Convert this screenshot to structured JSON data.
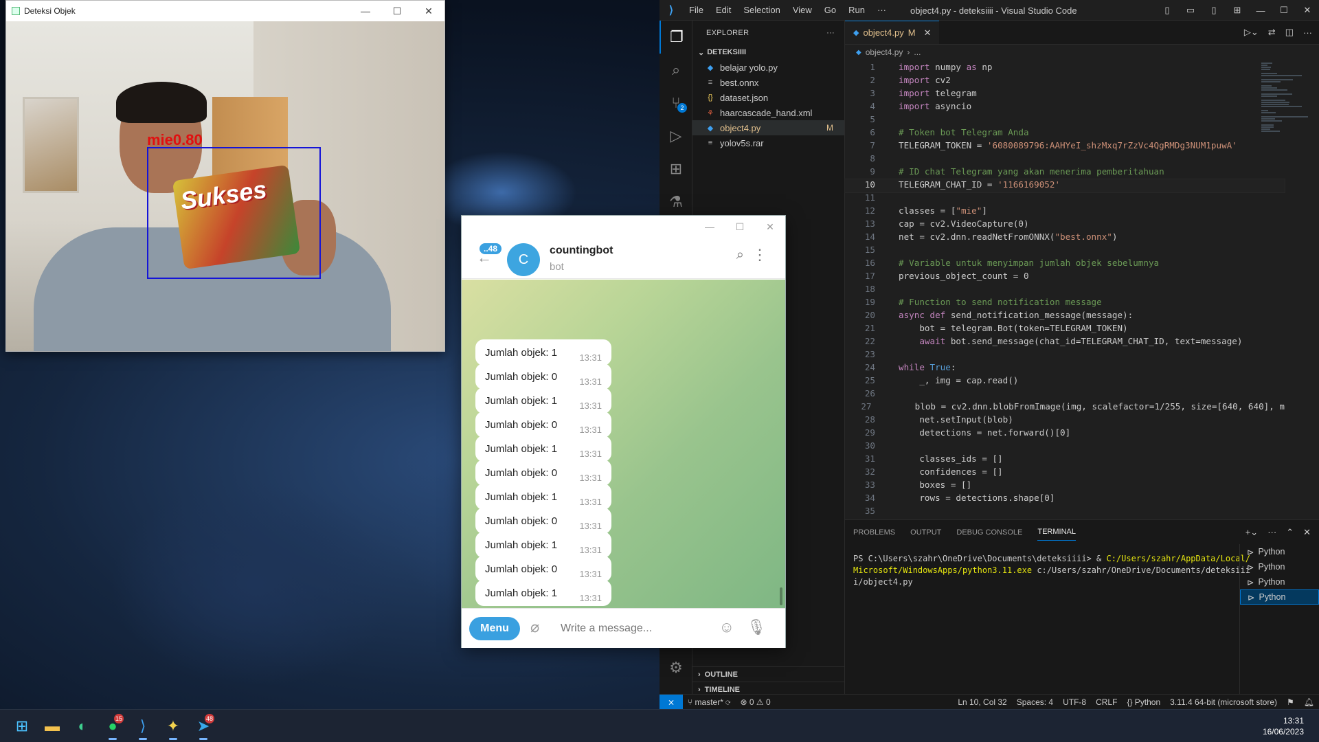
{
  "camera_window": {
    "title": "Deteksi Objek",
    "detection_label": "mie0.80",
    "package_text": "Sukses"
  },
  "vscode": {
    "window_title": "object4.py - deteksiiii - Visual Studio Code",
    "menu": [
      "File",
      "Edit",
      "Selection",
      "View",
      "Go",
      "Run",
      "···"
    ],
    "explorer_title": "EXPLORER",
    "folder": "DETEKSIIII",
    "files": [
      {
        "icon": "python-file-icon",
        "glyph": "◆",
        "color": "#3ea0f0",
        "name": "belajar yolo.py",
        "modified": ""
      },
      {
        "icon": "file-icon",
        "glyph": "≡",
        "color": "#aaaaaa",
        "name": "best.onnx",
        "modified": ""
      },
      {
        "icon": "json-file-icon",
        "glyph": "{}",
        "color": "#e8c65a",
        "name": "dataset.json",
        "modified": ""
      },
      {
        "icon": "xml-file-icon",
        "glyph": "⚘",
        "color": "#e06040",
        "name": "haarcascade_hand.xml",
        "modified": ""
      },
      {
        "icon": "python-file-icon",
        "glyph": "◆",
        "color": "#3ea0f0",
        "name": "object4.py",
        "modified": "M"
      },
      {
        "icon": "file-icon",
        "glyph": "≡",
        "color": "#aaaaaa",
        "name": "yolov5s.rar",
        "modified": ""
      }
    ],
    "outline": "OUTLINE",
    "timeline": "TIMELINE",
    "tab": {
      "name": "object4.py",
      "flag": "M"
    },
    "breadcrumb": [
      "object4.py",
      "›",
      "..."
    ],
    "code_lines": [
      "import numpy as np",
      "import cv2",
      "import telegram",
      "import asyncio",
      "",
      "# Token bot Telegram Anda",
      "TELEGRAM_TOKEN = '6080089796:AAHYeI_shzMxq7rZzVc4QgRMDg3NUM1puwA'",
      "",
      "# ID chat Telegram yang akan menerima pemberitahuan",
      "TELEGRAM_CHAT_ID = '1166169052'",
      "",
      "classes = [\"mie\"]",
      "cap = cv2.VideoCapture(0)",
      "net = cv2.dnn.readNetFromONNX(\"best.onnx\")",
      "",
      "# Variable untuk menyimpan jumlah objek sebelumnya",
      "previous_object_count = 0",
      "",
      "# Function to send notification message",
      "async def send_notification_message(message):",
      "    bot = telegram.Bot(token=TELEGRAM_TOKEN)",
      "    await bot.send_message(chat_id=TELEGRAM_CHAT_ID, text=message)",
      "",
      "while True:",
      "    _, img = cap.read()",
      "",
      "    blob = cv2.dnn.blobFromImage(img, scalefactor=1/255, size=[640, 640], m",
      "    net.setInput(blob)",
      "    detections = net.forward()[0]",
      "",
      "    classes_ids = []",
      "    confidences = []",
      "    boxes = []",
      "    rows = detections.shape[0]",
      ""
    ],
    "current_line": 10,
    "panel_tabs": [
      "PROBLEMS",
      "OUTPUT",
      "DEBUG CONSOLE",
      "TERMINAL"
    ],
    "active_panel_tab": "TERMINAL",
    "terminal_prompt": "PS C:\\Users\\szahr\\OneDrive\\Documents\\deteksiiii> & ",
    "terminal_exe": "C:/Users/szahr/AppData/Local/Microsoft/WindowsApps/python3.11.exe",
    "terminal_arg": " c:/Users/szahr/OneDrive/Documents/deteksiiii/object4.py",
    "terminals": [
      "Python",
      "Python",
      "Python",
      "Python"
    ],
    "status": {
      "branch": "master*",
      "errors": "0",
      "warnings": "0",
      "position": "Ln 10, Col 32",
      "spaces": "Spaces: 4",
      "encoding": "UTF-8",
      "eol": "CRLF",
      "language": "Python",
      "interpreter": "3.11.4 64-bit (microsoft store)"
    },
    "scm_badge": "2"
  },
  "telegram": {
    "unread": "..48",
    "avatar_letter": "C",
    "chat_name": "countingbot",
    "chat_sub": "bot",
    "messages": [
      {
        "text": "Jumlah objek: 1",
        "time": "13:31"
      },
      {
        "text": "Jumlah objek: 0",
        "time": "13:31"
      },
      {
        "text": "Jumlah objek: 1",
        "time": "13:31"
      },
      {
        "text": "Jumlah objek: 0",
        "time": "13:31"
      },
      {
        "text": "Jumlah objek: 1",
        "time": "13:31"
      },
      {
        "text": "Jumlah objek: 0",
        "time": "13:31"
      },
      {
        "text": "Jumlah objek: 1",
        "time": "13:31"
      },
      {
        "text": "Jumlah objek: 0",
        "time": "13:31"
      },
      {
        "text": "Jumlah objek: 1",
        "time": "13:31"
      },
      {
        "text": "Jumlah objek: 0",
        "time": "13:31"
      },
      {
        "text": "Jumlah objek: 1",
        "time": "13:31"
      }
    ],
    "menu_label": "Menu",
    "input_placeholder": "Write a message..."
  },
  "taskbar": {
    "apps": [
      {
        "name": "start-button",
        "glyph": "⊞",
        "color": "#4cc2ff",
        "badge": ""
      },
      {
        "name": "file-explorer-icon",
        "glyph": "▬",
        "color": "#f2c14e",
        "badge": ""
      },
      {
        "name": "edge-icon",
        "glyph": "◐",
        "color": "#3ecf8e",
        "badge": ""
      },
      {
        "name": "whatsapp-icon",
        "glyph": "●",
        "color": "#25d366",
        "badge": "15"
      },
      {
        "name": "vscode-icon",
        "glyph": "⟩",
        "color": "#3ea0f0",
        "badge": ""
      },
      {
        "name": "python-icon",
        "glyph": "✦",
        "color": "#f2d24e",
        "badge": ""
      },
      {
        "name": "telegram-icon",
        "glyph": "➤",
        "color": "#38a7e8",
        "badge": "48"
      }
    ],
    "time": "13:31",
    "date": "16/06/2023"
  }
}
